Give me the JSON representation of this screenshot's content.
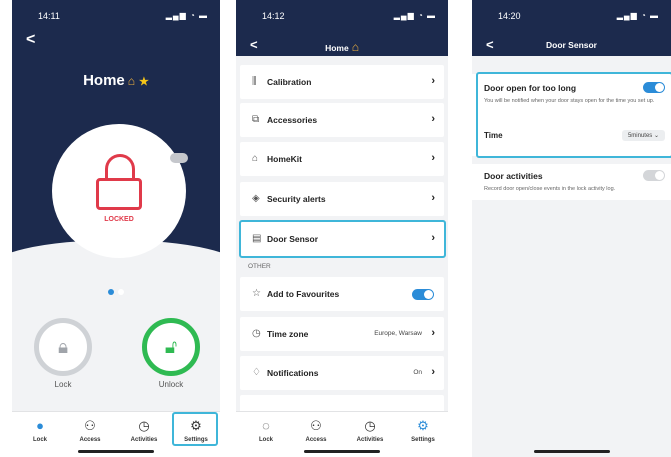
{
  "phone1": {
    "status_time": "14:11",
    "title": "Home",
    "lock_status": "LOCKED",
    "controls": {
      "lock_label": "Lock",
      "unlock_label": "Unlock"
    },
    "tabs": [
      {
        "label": "Lock",
        "icon": "lock-icon"
      },
      {
        "label": "Access",
        "icon": "people-icon"
      },
      {
        "label": "Activities",
        "icon": "clock-icon"
      },
      {
        "label": "Settings",
        "icon": "gear-icon"
      }
    ]
  },
  "phone2": {
    "status_time": "14:12",
    "title": "Home",
    "items": [
      {
        "label": "Calibration",
        "icon": "sliders-icon"
      },
      {
        "label": "Accessories",
        "icon": "accessories-icon"
      },
      {
        "label": "HomeKit",
        "icon": "homekit-icon"
      },
      {
        "label": "Security alerts",
        "icon": "shield-icon"
      },
      {
        "label": "Door Sensor",
        "icon": "door-sensor-icon"
      }
    ],
    "section_other": "OTHER",
    "other_items": [
      {
        "label": "Add to Favourites",
        "icon": "star-outline-icon"
      },
      {
        "label": "Time zone",
        "icon": "clock-icon",
        "value": "Europe, Warsaw"
      },
      {
        "label": "Notifications",
        "icon": "bell-icon",
        "value": "On"
      }
    ],
    "tabs": [
      {
        "label": "Lock"
      },
      {
        "label": "Access"
      },
      {
        "label": "Activities"
      },
      {
        "label": "Settings"
      }
    ]
  },
  "phone3": {
    "status_time": "14:20",
    "title": "Door Sensor",
    "door_open_title": "Door open for too long",
    "door_open_desc": "You will be notified when your door stays open for the time you set up.",
    "time_label": "Time",
    "time_value": "5minutes ⌄",
    "door_activities_title": "Door activities",
    "door_activities_desc": "Record door open/close events in the lock activity log."
  },
  "colors": {
    "navy": "#1c2a4d",
    "accent_blue": "#2b8cd8",
    "locked_red": "#e03a4a",
    "unlock_green": "#2fba52",
    "highlight_cyan": "#3fb6d9"
  }
}
